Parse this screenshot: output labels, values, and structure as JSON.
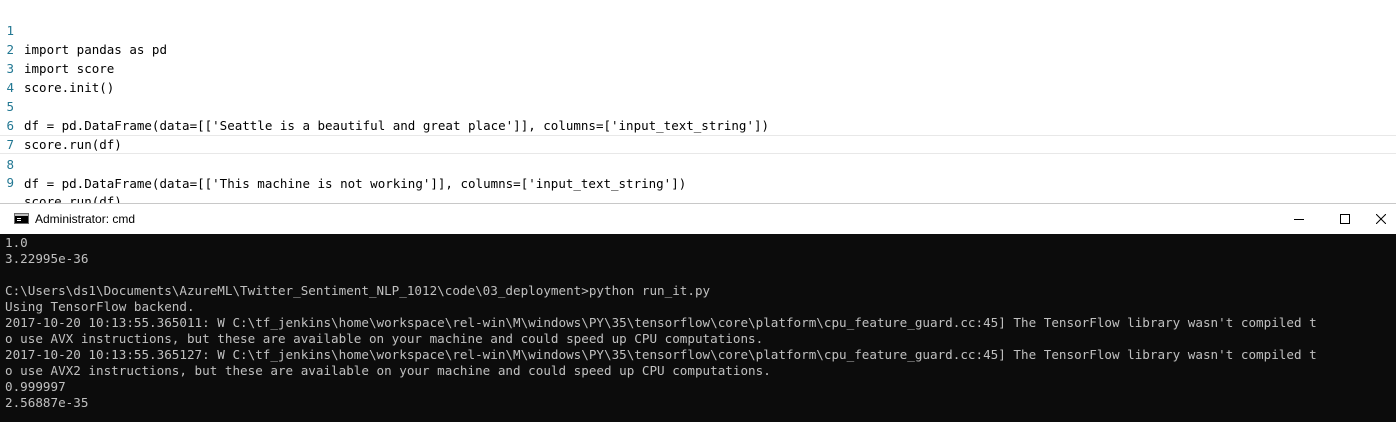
{
  "editor": {
    "lines": [
      {
        "num": "1",
        "text": "import pandas as pd"
      },
      {
        "num": "2",
        "text": "import score"
      },
      {
        "num": "3",
        "text": "score.init()"
      },
      {
        "num": "4",
        "text": ""
      },
      {
        "num": "5",
        "text": "df = pd.DataFrame(data=[['Seattle is a beautiful and great place']], columns=['input_text_string'])"
      },
      {
        "num": "6",
        "text": "score.run(df)"
      },
      {
        "num": "7",
        "text": ""
      },
      {
        "num": "8",
        "text": "df = pd.DataFrame(data=[['This machine is not working']], columns=['input_text_string'])"
      },
      {
        "num": "9",
        "text": "score.run(df)"
      }
    ],
    "current_line": "8"
  },
  "cmd": {
    "title": "Administrator: cmd",
    "icon": "console-app-icon",
    "controls": {
      "minimize": "minimize-icon",
      "maximize": "maximize-icon",
      "close": "close-icon"
    },
    "output_lines": [
      "1.0",
      "3.22995e-36",
      "",
      "C:\\Users\\ds1\\Documents\\AzureML\\Twitter_Sentiment_NLP_1012\\code\\03_deployment>python run_it.py",
      "Using TensorFlow backend.",
      "2017-10-20 10:13:55.365011: W C:\\tf_jenkins\\home\\workspace\\rel-win\\M\\windows\\PY\\35\\tensorflow\\core\\platform\\cpu_feature_guard.cc:45] The TensorFlow library wasn't compiled t",
      "o use AVX instructions, but these are available on your machine and could speed up CPU computations.",
      "2017-10-20 10:13:55.365127: W C:\\tf_jenkins\\home\\workspace\\rel-win\\M\\windows\\PY\\35\\tensorflow\\core\\platform\\cpu_feature_guard.cc:45] The TensorFlow library wasn't compiled t",
      "o use AVX2 instructions, but these are available on your machine and could speed up CPU computations.",
      "0.999997",
      "2.56887e-35"
    ]
  },
  "colors": {
    "line_number": "#237893",
    "console_bg": "#0c0c0c",
    "console_text": "#c0c0c0"
  }
}
